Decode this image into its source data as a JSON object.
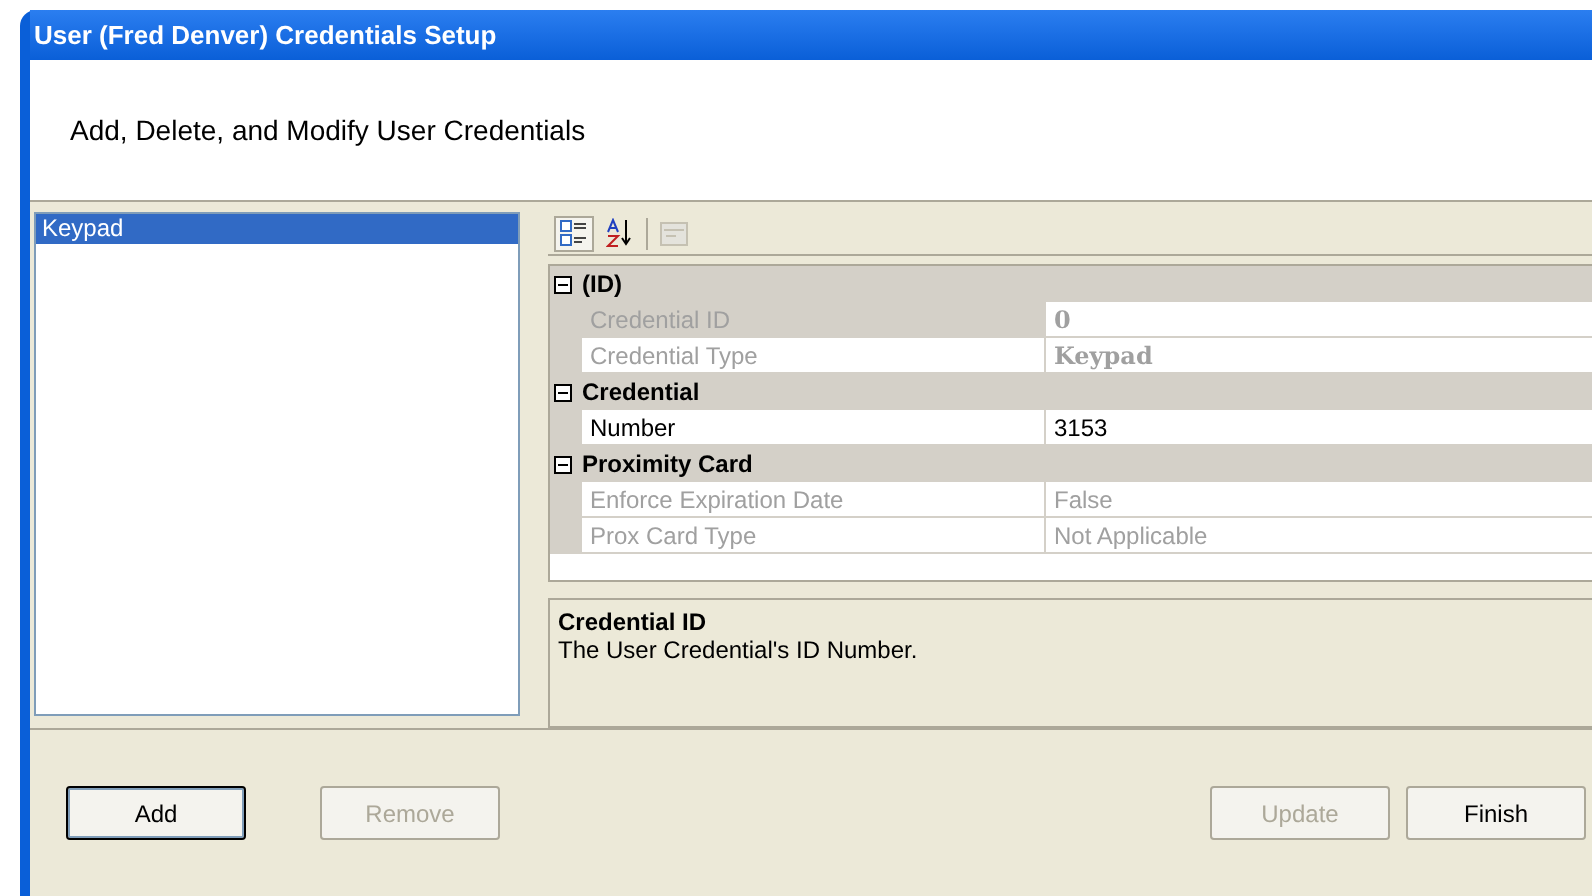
{
  "window": {
    "title": "User (Fred Denver) Credentials Setup"
  },
  "header": {
    "subtitle": "Add, Delete, and Modify User Credentials"
  },
  "credential_list": {
    "items": [
      {
        "label": "Keypad",
        "selected": true
      }
    ]
  },
  "property_grid": {
    "toolbar": [
      {
        "kind": "categorized",
        "selected": true,
        "disabled": false
      },
      {
        "kind": "alphabetical",
        "selected": false,
        "disabled": false
      },
      {
        "kind": "pages",
        "selected": false,
        "disabled": true
      }
    ],
    "categories": [
      {
        "name": "(ID)",
        "expanded": true,
        "properties": [
          {
            "name": "Credential ID",
            "value": "0",
            "disabled": true,
            "bold": true,
            "selected": true
          },
          {
            "name": "Credential Type",
            "value": "Keypad",
            "disabled": true,
            "bold": true,
            "selected": false
          }
        ]
      },
      {
        "name": "Credential",
        "expanded": true,
        "properties": [
          {
            "name": "Number",
            "value": "3153",
            "disabled": false,
            "bold": false,
            "selected": false
          }
        ]
      },
      {
        "name": "Proximity Card",
        "expanded": true,
        "properties": [
          {
            "name": "Enforce Expiration Date",
            "value": "False",
            "disabled": true,
            "bold": false,
            "selected": false
          },
          {
            "name": "Prox Card Type",
            "value": "Not Applicable",
            "disabled": true,
            "bold": false,
            "selected": false
          }
        ]
      }
    ],
    "description": {
      "title": "Credential ID",
      "text": "The User Credential's ID Number."
    }
  },
  "buttons": {
    "left": [
      {
        "label": "Add",
        "disabled": false,
        "default": true
      },
      {
        "label": "Remove",
        "disabled": true,
        "default": false
      }
    ],
    "right": [
      {
        "label": "Update",
        "disabled": true,
        "default": false
      },
      {
        "label": "Finish",
        "disabled": false,
        "default": false
      }
    ]
  }
}
